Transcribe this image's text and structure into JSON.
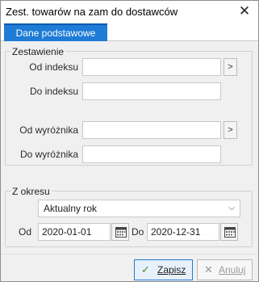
{
  "window": {
    "title": "Zest. towarów na zam do dostawców",
    "close_icon": "close-icon"
  },
  "tabs": [
    {
      "label": "Dane podstawowe",
      "active": true
    }
  ],
  "zestawienie": {
    "title": "Zestawienie",
    "od_indeksu_label": "Od indeksu",
    "od_indeksu_value": "",
    "do_indeksu_label": "Do indeksu",
    "do_indeksu_value": "",
    "od_wyroznika_label": "Od wyróżnika",
    "od_wyroznika_value": "",
    "do_wyroznika_label": "Do wyróżnika",
    "do_wyroznika_value": "",
    "pick_glyph": ">"
  },
  "okres": {
    "title": "Z okresu",
    "period_selected": "Aktualny rok",
    "od_label": "Od",
    "od_value": "2020-01-01",
    "do_label": "Do",
    "do_value": "2020-12-31"
  },
  "buttons": {
    "save_label": "Zapisz",
    "save_icon": "check-icon",
    "cancel_label": "Anuluj",
    "cancel_icon": "x-icon"
  },
  "colors": {
    "accent": "#1e7bd6",
    "tab_text": "#ffffff"
  }
}
